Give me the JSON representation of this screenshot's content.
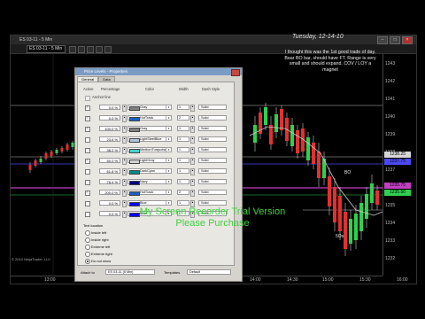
{
  "window": {
    "title": "ES 03-11 - 5 Min",
    "toolbar_instrument": "ES 03-11 - 5 Min"
  },
  "chart": {
    "date": "Tuesday, 12-14-10",
    "note": "I thought this was the 1st good trade of day. Bear BO bar, should have FT. Range is very small and should expand. COV / LOY a magnet",
    "labels": [
      "BO",
      "5Os"
    ],
    "price_ticks": [
      "1243",
      "1242",
      "1241",
      "1240",
      "1239",
      "1238",
      "1237",
      "1236",
      "1235",
      "1234",
      "1233",
      "1232"
    ],
    "time_ticks": [
      "13:00",
      "15:00",
      "14:00",
      "14:30",
      "15:00",
      "15:30",
      "16:00"
    ],
    "price_boxes": [
      {
        "text": "1238.25",
        "color": "#d6d6d6"
      },
      {
        "text": "1237.75",
        "color": "#4a4af0"
      },
      {
        "text": "1235.75",
        "color": "#c040c0"
      },
      {
        "text": "1235.50",
        "color": "#2fd04f"
      }
    ],
    "copyright": "© 2010 NinjaTrader, LLC"
  },
  "dialog": {
    "title": "Price Levels - Properties",
    "tabs": [
      "General",
      "Data"
    ],
    "headers": {
      "active": "Active",
      "percentage": "Percentage",
      "color": "Color",
      "width": "Width",
      "dash": "Dash Style"
    },
    "anchor_label": "Anchor line",
    "rows": [
      {
        "pct": "0.0 %",
        "color_name": "Gray",
        "color": "#808080",
        "width": "1",
        "dash": "Solid",
        "on": true
      },
      {
        "pct": "0.0 %",
        "color_name": "HotTrack",
        "color": "#1d5fbf",
        "width": "2",
        "dash": "Solid",
        "on": true
      },
      {
        "pct": "100.0 %",
        "color_name": "Gray",
        "color": "#808080",
        "width": "1",
        "dash": "Solid",
        "on": true
      },
      {
        "pct": "23.6 %",
        "color_name": "LightSteelBlue",
        "color": "#b0c4de",
        "width": "1",
        "dash": "Solid",
        "on": false
      },
      {
        "pct": "38.2 %",
        "color_name": "MediumTurquoise",
        "color": "#48d1cc",
        "width": "1",
        "dash": "Solid",
        "on": false
      },
      {
        "pct": "50.0 %",
        "color_name": "LightGray",
        "color": "#d3d3d3",
        "width": "1",
        "dash": "Solid",
        "on": true
      },
      {
        "pct": "61.8 %",
        "color_name": "DarkCyan",
        "color": "#008b8b",
        "width": "1",
        "dash": "Solid",
        "on": false
      },
      {
        "pct": "76.4 %",
        "color_name": "Navy",
        "color": "#000080",
        "width": "1",
        "dash": "Solid",
        "on": false
      },
      {
        "pct": "200.0 %",
        "color_name": "HotTrack",
        "color": "#1d5fbf",
        "width": "2",
        "dash": "Solid",
        "on": true
      },
      {
        "pct": "0.0 %",
        "color_name": "Blue",
        "color": "#0000ff",
        "width": "1",
        "dash": "Solid",
        "on": false
      },
      {
        "pct": "0.0 %",
        "color_name": "Blue",
        "color": "#0000ff",
        "width": "1",
        "dash": "Solid",
        "on": false
      }
    ],
    "text_location_label": "Text location",
    "text_locations": [
      "Inside left",
      "Inside right",
      "Extreme left",
      "Extreme right",
      "Do not show"
    ],
    "text_location_selected": 4,
    "attach_to_label": "Attach to",
    "attach_to_value": "ES 03-11 (5 Min)",
    "template_label": "Templates",
    "template_value": "Default"
  },
  "watermark": {
    "line1": "My Screen Recorder Trial Version",
    "line2": "Please Purchase"
  }
}
